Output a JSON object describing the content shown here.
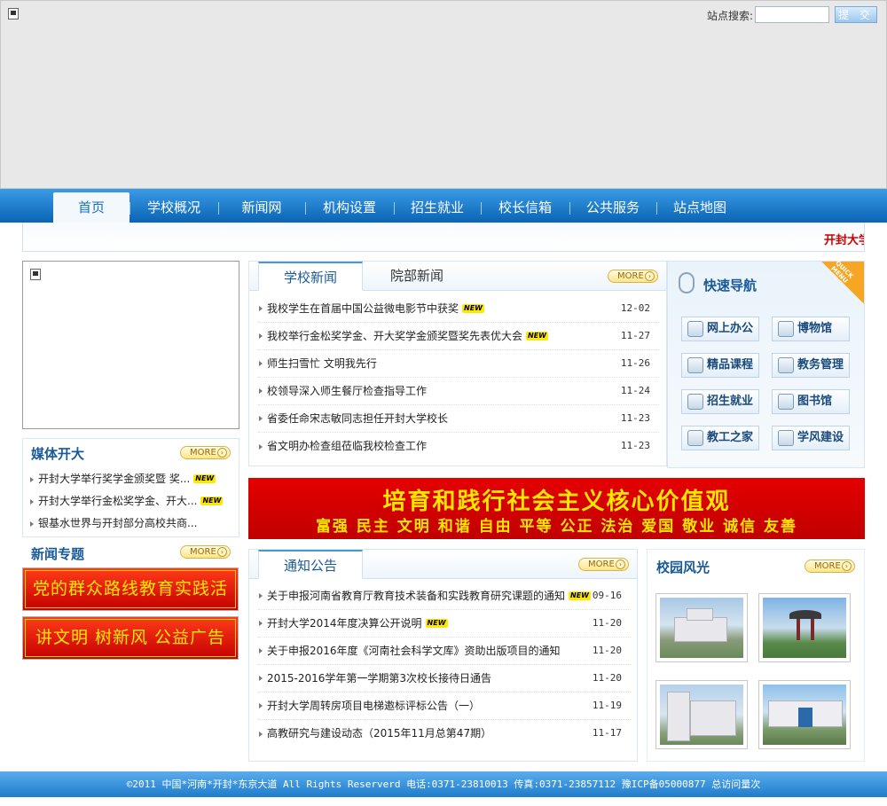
{
  "header": {
    "search_label": "站点搜索:",
    "search_placeholder": "",
    "search_button": "提 交"
  },
  "nav": {
    "items": [
      {
        "label": "首页",
        "active": true
      },
      {
        "label": "学校概况"
      },
      {
        "label": "新闻网"
      },
      {
        "label": "机构设置"
      },
      {
        "label": "招生就业"
      },
      {
        "label": "校长信箱"
      },
      {
        "label": "公共服务"
      },
      {
        "label": "站点地图"
      }
    ]
  },
  "marquee": {
    "text": "开封大学"
  },
  "more_label": "MORE",
  "media": {
    "title": "媒体开大",
    "items": [
      {
        "text": "开封大学举行奖学金颁奖暨 奖...",
        "new": true
      },
      {
        "text": "开封大学举行金松奖学金、开大...",
        "new": true
      },
      {
        "text": "银基水世界与开封部分高校共商...",
        "new": false
      }
    ]
  },
  "topics": {
    "title": "新闻专题",
    "banners": [
      "党的群众路线教育实践活动",
      "讲文明 树新风 公益广告"
    ]
  },
  "news": {
    "tabs": [
      "学校新闻",
      "院部新闻"
    ],
    "items": [
      {
        "text": "我校学生在首届中国公益微电影节中获奖",
        "new": true,
        "date": "12-02"
      },
      {
        "text": "我校举行金松奖学金、开大奖学金颁奖暨奖先表优大会",
        "new": true,
        "date": "11-27"
      },
      {
        "text": "师生扫雪忙 文明我先行",
        "new": false,
        "date": "11-26"
      },
      {
        "text": "校领导深入师生餐厅检查指导工作",
        "new": false,
        "date": "11-24"
      },
      {
        "text": "省委任命宋志敏同志担任开封大学校长",
        "new": false,
        "date": "11-23"
      },
      {
        "text": "省文明办检查组莅临我校检查工作",
        "new": false,
        "date": "11-23"
      }
    ]
  },
  "quick_nav": {
    "title": "快速导航",
    "corner": "QUICK MENU",
    "buttons": [
      "网上办公",
      "博物馆",
      "精品课程",
      "教务管理",
      "招生就业",
      "图书馆",
      "教工之家",
      "学风建设"
    ]
  },
  "slogan": {
    "line1": "培育和践行社会主义核心价值观",
    "line2": "富强 民主 文明 和谐   自由 平等 公正 法治   爱国 敬业 诚信 友善"
  },
  "notice": {
    "tab": "通知公告",
    "items": [
      {
        "text": "关于申报河南省教育厅教育技术装备和实践教育研究课题的通知",
        "new": true,
        "date": "09-16"
      },
      {
        "text": "开封大学2014年度决算公开说明",
        "new": true,
        "date": "11-20"
      },
      {
        "text": "关于申报2016年度《河南社会科学文库》资助出版项目的通知",
        "new": false,
        "date": "11-20"
      },
      {
        "text": "2015-2016学年第一学期第3次校长接待日通告",
        "new": false,
        "date": "11-20"
      },
      {
        "text": "开封大学周转房项目电梯邀标评标公告（一）",
        "new": false,
        "date": "11-19"
      },
      {
        "text": "高教研究与建设动态（2015年11月总第47期）",
        "new": false,
        "date": "11-17"
      }
    ]
  },
  "campus": {
    "title": "校园风光"
  },
  "footer": {
    "text": "©2011 中国*河南*开封*东京大道 All Rights Reserverd 电话:0371-23810013 传真:0371-23857112 豫ICP备05000877 总访问量次"
  },
  "new_tag": "NEW"
}
